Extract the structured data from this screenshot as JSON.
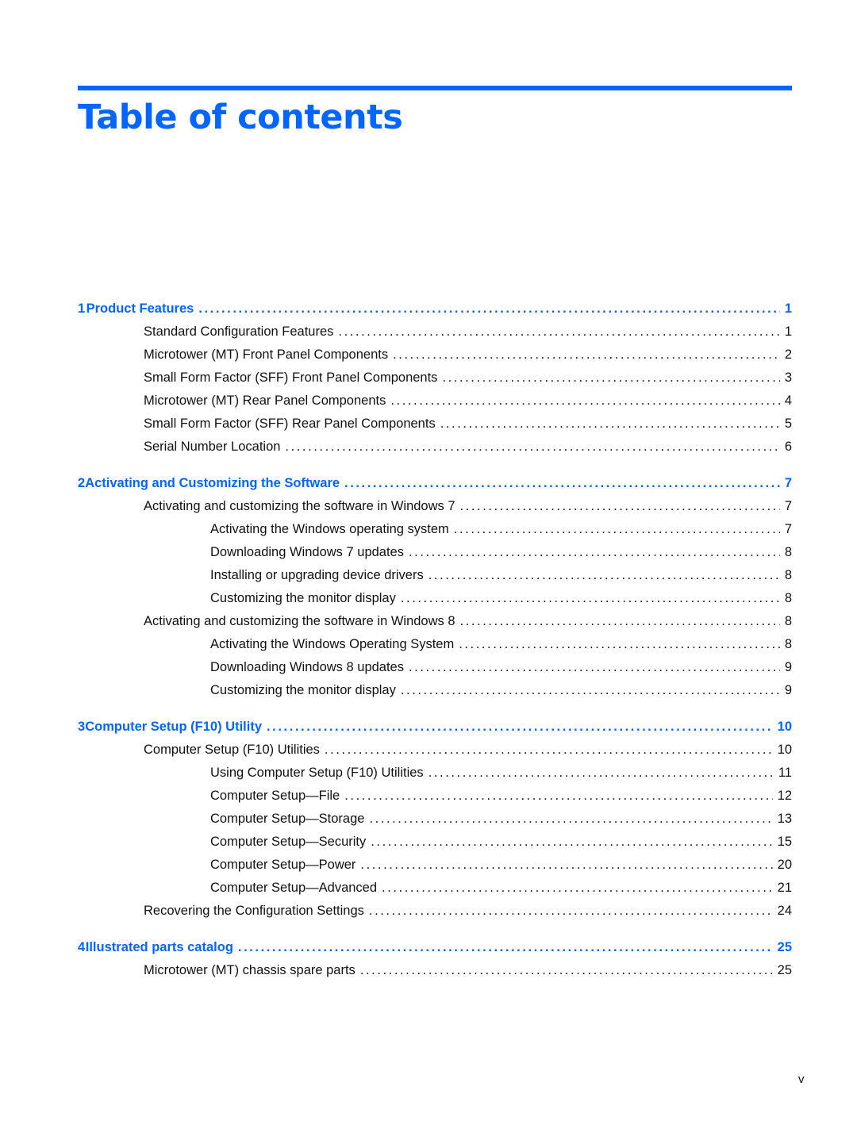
{
  "title": "Table of contents",
  "accent_color": "#0066ff",
  "page_number": "v",
  "chapters": [
    {
      "number": "1",
      "title": "Product Features",
      "page": "1",
      "entries": [
        {
          "level": 1,
          "title": "Standard Configuration Features",
          "page": "1"
        },
        {
          "level": 1,
          "title": "Microtower (MT) Front Panel Components",
          "page": "2"
        },
        {
          "level": 1,
          "title": "Small Form Factor (SFF) Front Panel Components",
          "page": "3"
        },
        {
          "level": 1,
          "title": "Microtower (MT) Rear Panel Components",
          "page": "4"
        },
        {
          "level": 1,
          "title": "Small Form Factor (SFF) Rear Panel Components",
          "page": "5"
        },
        {
          "level": 1,
          "title": "Serial Number Location",
          "page": "6"
        }
      ]
    },
    {
      "number": "2",
      "title": "Activating and Customizing the Software",
      "page": "7",
      "entries": [
        {
          "level": 1,
          "title": "Activating and customizing the software in Windows 7",
          "page": "7"
        },
        {
          "level": 2,
          "title": "Activating the Windows operating system",
          "page": "7"
        },
        {
          "level": 2,
          "title": "Downloading Windows 7 updates",
          "page": "8"
        },
        {
          "level": 2,
          "title": "Installing or upgrading device drivers",
          "page": "8"
        },
        {
          "level": 2,
          "title": "Customizing the monitor display",
          "page": "8"
        },
        {
          "level": 1,
          "title": "Activating and customizing the software in Windows 8",
          "page": "8"
        },
        {
          "level": 2,
          "title": "Activating the Windows Operating System",
          "page": "8"
        },
        {
          "level": 2,
          "title": "Downloading Windows 8 updates",
          "page": "9"
        },
        {
          "level": 2,
          "title": "Customizing the monitor display",
          "page": "9"
        }
      ]
    },
    {
      "number": "3",
      "title": "Computer Setup (F10) Utility",
      "page": "10",
      "entries": [
        {
          "level": 1,
          "title": "Computer Setup (F10) Utilities",
          "page": "10"
        },
        {
          "level": 2,
          "title": "Using Computer Setup (F10) Utilities",
          "page": "11"
        },
        {
          "level": 2,
          "title": "Computer Setup—File",
          "page": "12"
        },
        {
          "level": 2,
          "title": "Computer Setup—Storage",
          "page": "13"
        },
        {
          "level": 2,
          "title": "Computer Setup—Security",
          "page": "15"
        },
        {
          "level": 2,
          "title": "Computer Setup—Power",
          "page": "20"
        },
        {
          "level": 2,
          "title": "Computer Setup—Advanced",
          "page": "21"
        },
        {
          "level": 1,
          "title": "Recovering the Configuration Settings",
          "page": "24"
        }
      ]
    },
    {
      "number": "4",
      "title": "Illustrated parts catalog",
      "page": "25",
      "entries": [
        {
          "level": 1,
          "title": "Microtower (MT) chassis spare parts",
          "page": "25"
        }
      ]
    }
  ]
}
